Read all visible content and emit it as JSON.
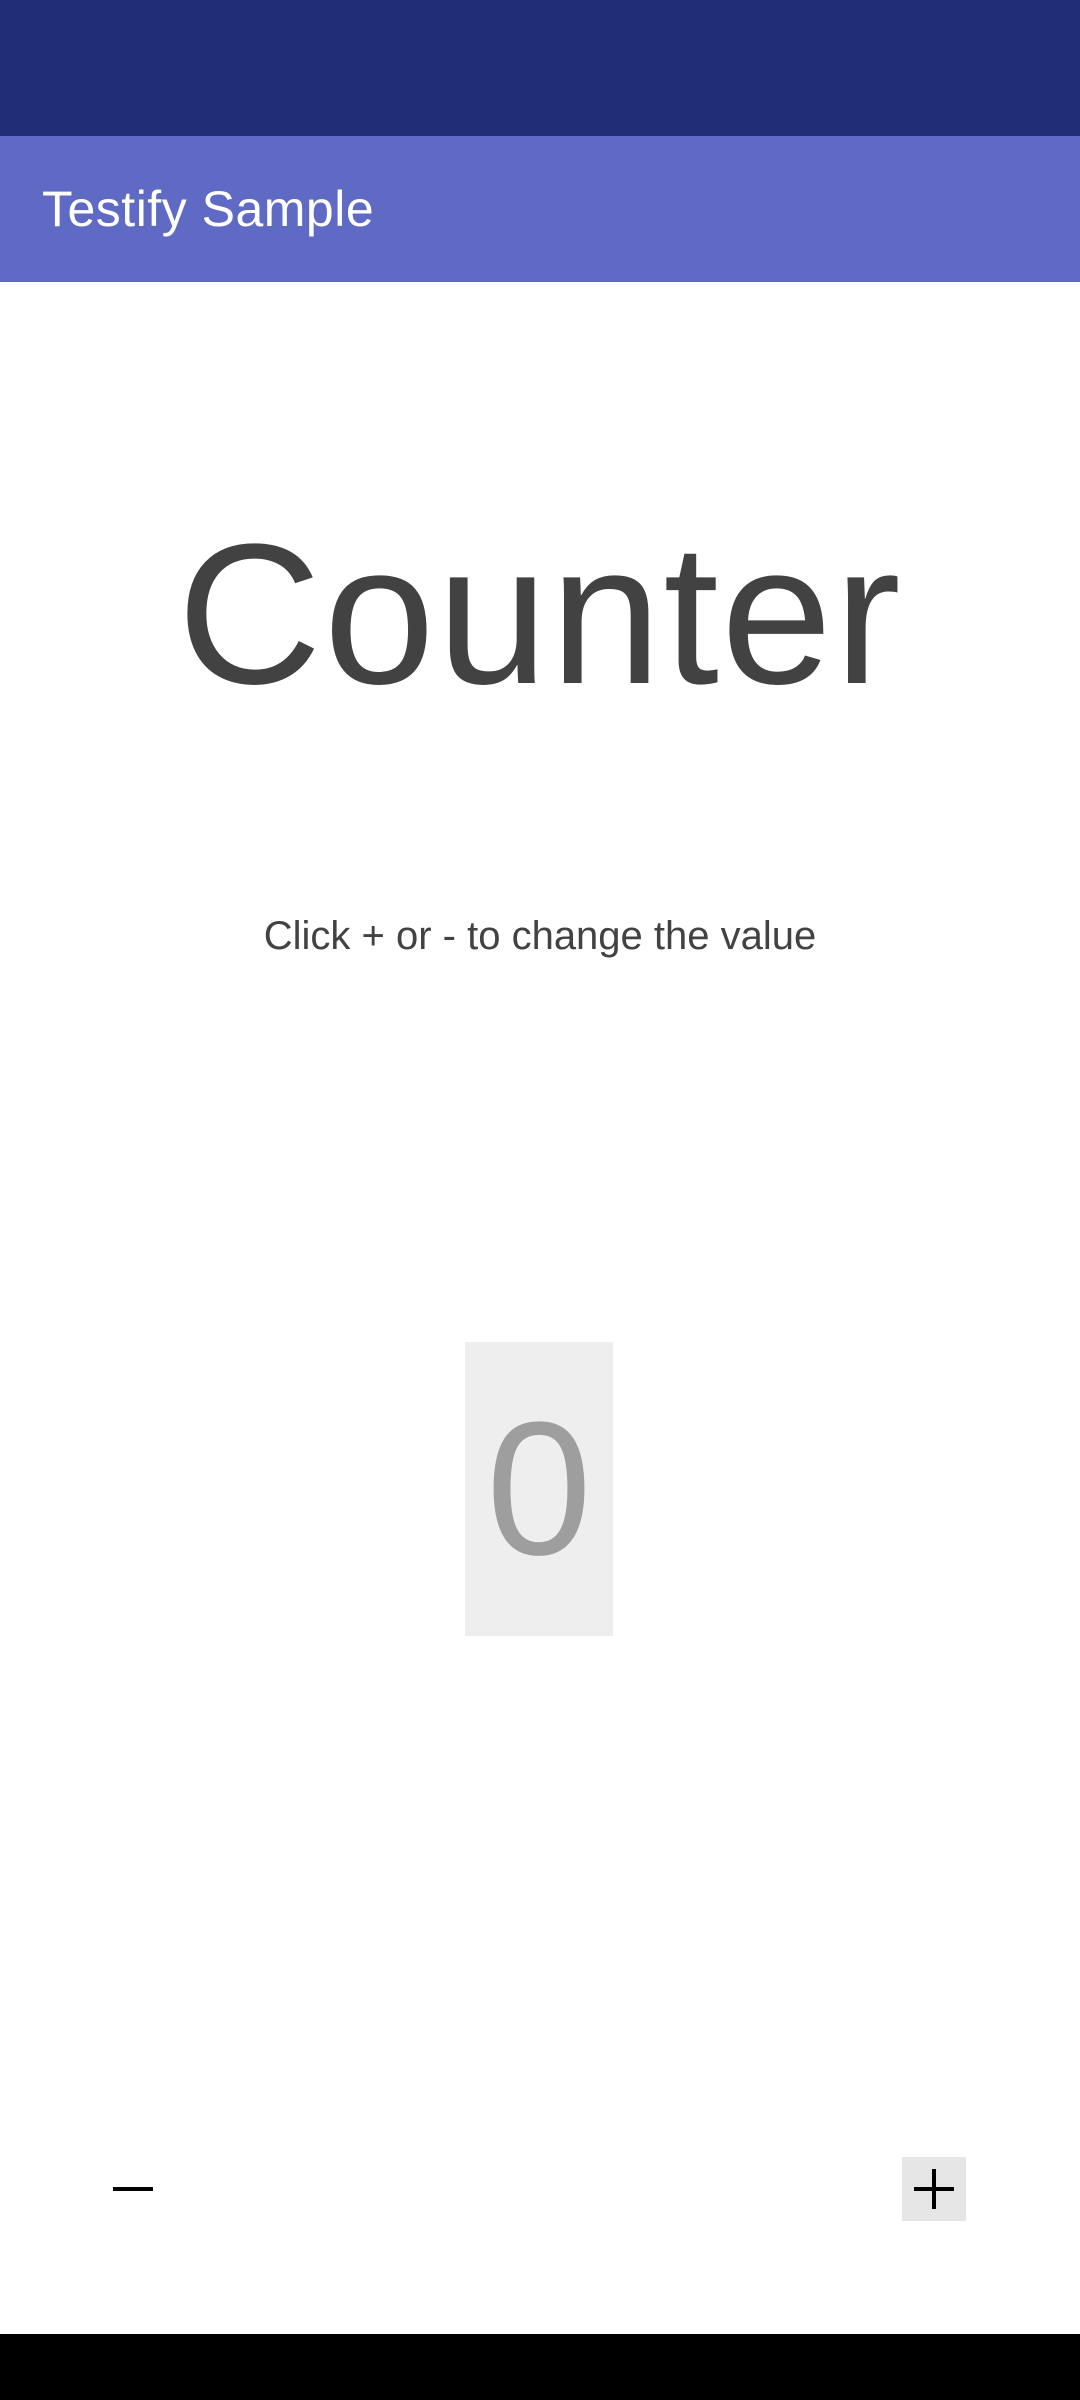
{
  "app_bar": {
    "title": "Testify Sample"
  },
  "main": {
    "heading": "Counter",
    "instruction": "Click + or - to change the value",
    "counter_value": "0"
  },
  "controls": {
    "decrement_icon": "minus-icon",
    "increment_icon": "plus-icon"
  },
  "colors": {
    "status_bar": "#212d77",
    "app_bar": "#5f6ac4",
    "text_primary": "#424242",
    "counter_bg": "#eeeeee",
    "counter_text": "#9e9e9e"
  }
}
